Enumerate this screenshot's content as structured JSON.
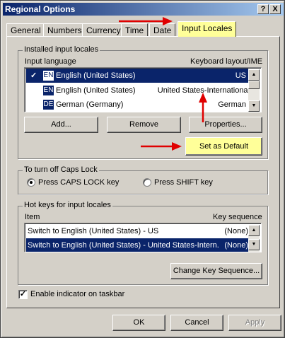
{
  "window": {
    "title": "Regional Options",
    "help_glyph": "?",
    "close_glyph": "X"
  },
  "tabs": [
    {
      "label": "General"
    },
    {
      "label": "Numbers"
    },
    {
      "label": "Currency"
    },
    {
      "label": "Time"
    },
    {
      "label": "Date"
    },
    {
      "label": "Input Locales"
    }
  ],
  "installed": {
    "group_label": "Installed input locales",
    "col_language": "Input language",
    "col_layout": "Keyboard layout/IME",
    "rows": [
      {
        "check": "✓",
        "badge": "EN",
        "language": "English (United States)",
        "layout": "US"
      },
      {
        "check": "",
        "badge": "EN",
        "language": "English (United States)",
        "layout": "United States-International"
      },
      {
        "check": "",
        "badge": "DE",
        "language": "German (Germany)",
        "layout": "German"
      }
    ],
    "buttons": {
      "add": "Add...",
      "remove": "Remove",
      "properties": "Properties...",
      "set_default": "Set as Default"
    }
  },
  "capslock": {
    "group_label": "To turn off Caps Lock",
    "option_caps": "Press CAPS LOCK key",
    "option_shift": "Press SHIFT key"
  },
  "hotkeys": {
    "group_label": "Hot keys for input locales",
    "col_item": "Item",
    "col_seq": "Key sequence",
    "rows": [
      {
        "item": "Switch to English (United States) - US",
        "seq": "(None)"
      },
      {
        "item": "Switch to English (United States) - United States-Intern...",
        "seq": "(None)"
      }
    ],
    "change_button": "Change Key Sequence..."
  },
  "taskbar_indicator": {
    "label": "Enable indicator on taskbar",
    "check": "✓"
  },
  "footer": {
    "ok": "OK",
    "cancel": "Cancel",
    "apply": "Apply"
  },
  "colors": {
    "highlight": "#ffff99",
    "arrow": "#e00000",
    "selection": "#0a246a"
  }
}
